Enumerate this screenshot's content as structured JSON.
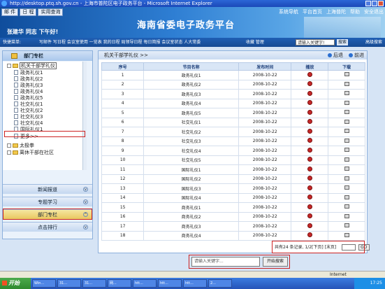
{
  "window": {
    "title": "http://desktop.ptq.sh.gov.cn - 上海市普陀区电子政务平台 - Microsoft Internet Explorer"
  },
  "banner": {
    "top_buttons": [
      "邮 件",
      "日 程",
      "实用查询"
    ],
    "title": "海南省委电子政务平台",
    "greeting": "张建华  同志  下午好!",
    "right_links": [
      "系统导航",
      "平台首页",
      "上海普陀",
      "帮助",
      "安全退出"
    ]
  },
  "toolbar": {
    "label": "快捷菜单:",
    "items": "写邮件  写日程  会议室使用  一览表  我的日程  局领导日程  每日简报  会议室状态  人大常委",
    "favorites": "收藏  管理",
    "search_value": "请输入关键字!",
    "search_button": "搜索",
    "advanced": "高级搜索"
  },
  "sidebar": {
    "header": "部门专栏",
    "tree": {
      "root": "机关干部学礼仪",
      "leaves": [
        "政务礼仪1",
        "政务礼仪2",
        "政务礼仪3",
        "政务礼仪4",
        "政务礼仪5",
        "社交礼仪1",
        "社交礼仪2",
        "社交礼仪3",
        "社交礼仪4",
        "国际礼仪1",
        "更多>>"
      ],
      "sibling1": "太极拳",
      "sibling2": "离休干部在社区"
    },
    "buttons": [
      "新闻报道",
      "专题学习",
      "部门专栏",
      "点击排行"
    ]
  },
  "content": {
    "breadcrumb": "机关干部学礼仪  >>",
    "nav_back": "后退",
    "nav_forward": "前进",
    "columns": [
      "序号",
      "节目名称",
      "发布时间",
      "播放",
      "下载"
    ],
    "rows": [
      [
        "1",
        "政务礼仪1",
        "2008-10-22"
      ],
      [
        "2",
        "政务礼仪2",
        "2008-10-22"
      ],
      [
        "3",
        "政务礼仪3",
        "2008-10-22"
      ],
      [
        "4",
        "政务礼仪4",
        "2008-10-22"
      ],
      [
        "5",
        "政务礼仪5",
        "2008-10-22"
      ],
      [
        "6",
        "社交礼仪1",
        "2008-10-22"
      ],
      [
        "7",
        "社交礼仪2",
        "2008-10-22"
      ],
      [
        "8",
        "社交礼仪3",
        "2008-10-22"
      ],
      [
        "9",
        "社交礼仪4",
        "2008-10-22"
      ],
      [
        "10",
        "社交礼仪5",
        "2008-10-22"
      ],
      [
        "11",
        "国际礼仪1",
        "2008-10-22"
      ],
      [
        "12",
        "国际礼仪2",
        "2008-10-22"
      ],
      [
        "13",
        "国际礼仪3",
        "2008-10-22"
      ],
      [
        "14",
        "国际礼仪4",
        "2008-10-22"
      ],
      [
        "15",
        "商务礼仪1",
        "2008-10-22"
      ],
      [
        "16",
        "商务礼仪2",
        "2008-10-22"
      ],
      [
        "17",
        "商务礼仪3",
        "2008-10-22"
      ],
      [
        "18",
        "商务礼仪4",
        "2008-10-22"
      ]
    ],
    "pager": "共有24 条记录, 1/2[下页] [末页]",
    "go": "GO"
  },
  "bottom_search": {
    "placeholder": "请输入关键字...",
    "button": "开始搜索"
  },
  "statusbar": {
    "zone": "Internet"
  },
  "taskbar": {
    "start": "开始",
    "tasks": [
      "Win...",
      "31...",
      "31...",
      "网...",
      "htt...",
      "htt...",
      "htt...",
      "2..."
    ],
    "clock": "17:25"
  },
  "colors": {
    "accent": "#1f5fb4",
    "highlight_box": "#cc2222",
    "play_icon": "#c62828"
  }
}
